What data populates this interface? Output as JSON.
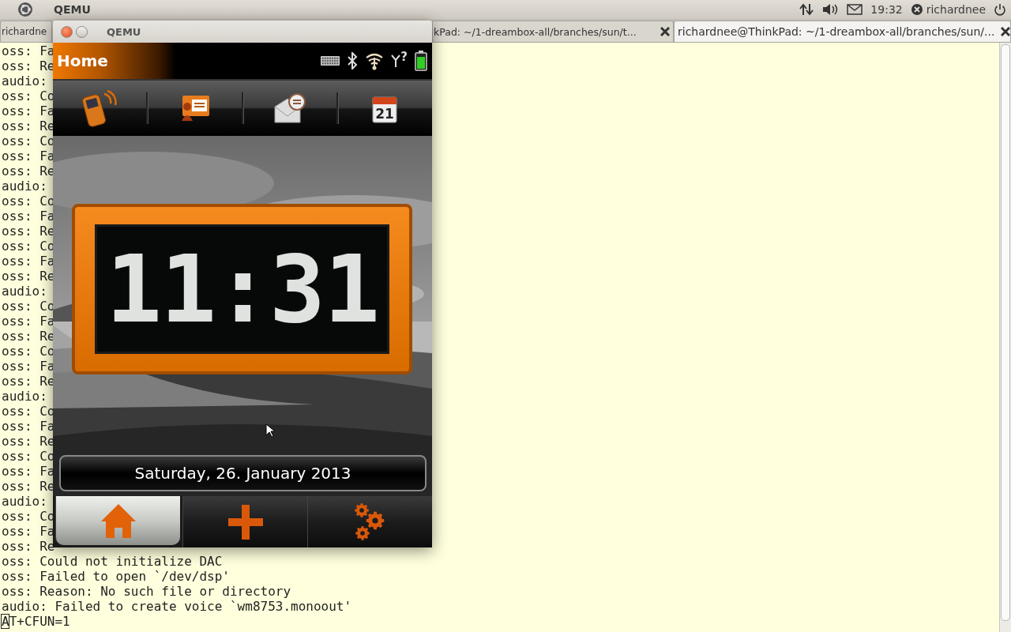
{
  "top_panel": {
    "app_title": "QEMU",
    "clock": "19:32",
    "user": "richardnee"
  },
  "tabs": [
    {
      "label": "richardne",
      "selected": false
    },
    {
      "label": "kPad: ~/1-dreambox-all/branches/sun/t...",
      "selected": false,
      "close_button": true
    },
    {
      "label": "richardnee@ThinkPad: ~/1-dreambox-all/branches/sun/...",
      "selected": true,
      "close_button": true
    }
  ],
  "terminal": {
    "lines": [
      "oss: Fa",
      "oss: Re",
      "audio:",
      "oss: Co",
      "oss: Fa",
      "oss: Re",
      "oss: Co",
      "oss: Fa",
      "oss: Re",
      "audio:",
      "oss: Co",
      "oss: Fa",
      "oss: Re",
      "oss: Co",
      "oss: Fa",
      "oss: Re",
      "audio:",
      "oss: Co",
      "oss: Fa",
      "oss: Re",
      "oss: Co",
      "oss: Fa",
      "oss: Re",
      "audio:",
      "oss: Co",
      "oss: Fa",
      "oss: Re",
      "oss: Co",
      "oss: Fa",
      "oss: Re",
      "audio:",
      "oss: Co",
      "oss: Fa",
      "oss: Re",
      "oss: Could not initialize DAC",
      "oss: Failed to open `/dev/dsp'",
      "oss: Reason: No such file or directory",
      "audio: Failed to create voice `wm8753.monoout'"
    ],
    "input_line": {
      "text": "AT+CFUN=1",
      "cursor": true
    }
  },
  "qemu_window": {
    "title": "QEMU",
    "screen": {
      "header_title": "Home",
      "signal_status": "?",
      "shortcuts": [
        {
          "kind": "phone"
        },
        {
          "kind": "contact"
        },
        {
          "kind": "message"
        },
        {
          "kind": "calendar",
          "day": "21"
        }
      ],
      "clock": "11:31",
      "date": "Saturday, 26. January 2013",
      "nav": [
        {
          "kind": "home",
          "selected": true
        },
        {
          "kind": "add",
          "selected": false
        },
        {
          "kind": "settings",
          "selected": false
        }
      ]
    }
  }
}
